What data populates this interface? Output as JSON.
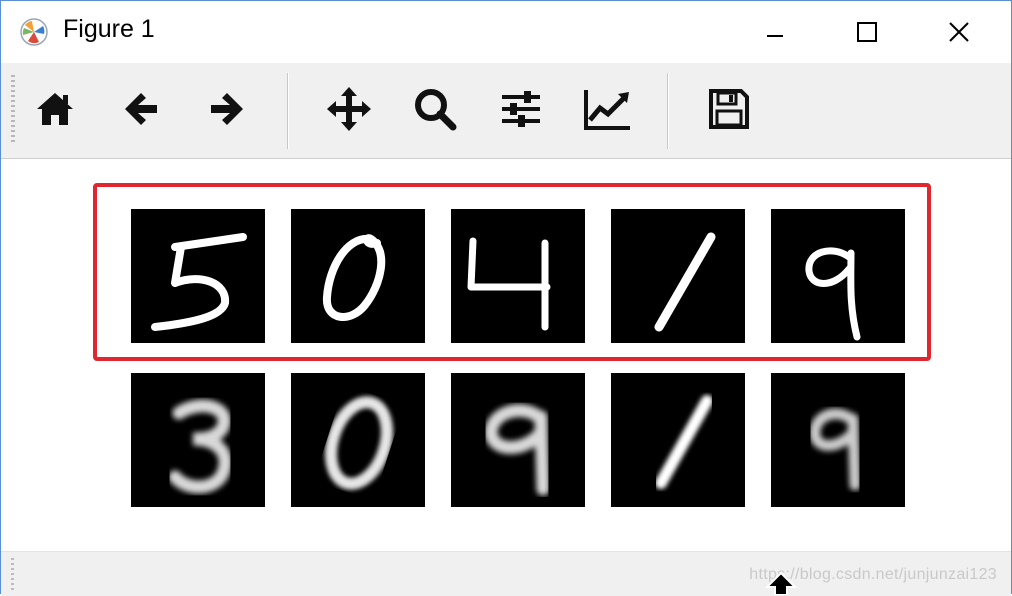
{
  "window": {
    "title": "Figure 1",
    "icon": "matplotlib-logo-icon",
    "controls": [
      "minimize-icon",
      "maximize-icon",
      "close-icon"
    ]
  },
  "toolbar": {
    "tools": [
      {
        "name": "home",
        "icon": "home-icon"
      },
      {
        "name": "back",
        "icon": "arrow-left-icon"
      },
      {
        "name": "forward",
        "icon": "arrow-right-icon"
      },
      {
        "name": "pan",
        "icon": "move-icon"
      },
      {
        "name": "zoom",
        "icon": "magnifier-icon"
      },
      {
        "name": "configure-subplots",
        "icon": "sliders-icon"
      },
      {
        "name": "edit-axes",
        "icon": "line-chart-icon"
      },
      {
        "name": "save",
        "icon": "floppy-disk-icon"
      }
    ]
  },
  "figure": {
    "top_row_highlight_color": "#e0262e",
    "top_row": [
      {
        "digit": "5",
        "style": "original"
      },
      {
        "digit": "0",
        "style": "original"
      },
      {
        "digit": "4",
        "style": "original"
      },
      {
        "digit": "1",
        "style": "original"
      },
      {
        "digit": "9",
        "style": "original"
      }
    ],
    "bottom_row": [
      {
        "digit": "3",
        "style": "reconstructed"
      },
      {
        "digit": "0",
        "style": "reconstructed"
      },
      {
        "digit": "9",
        "style": "reconstructed"
      },
      {
        "digit": "1",
        "style": "reconstructed"
      },
      {
        "digit": "9",
        "style": "reconstructed"
      }
    ]
  },
  "statusbar": {
    "watermark": "https://blog.csdn.net/junjunzai123"
  }
}
